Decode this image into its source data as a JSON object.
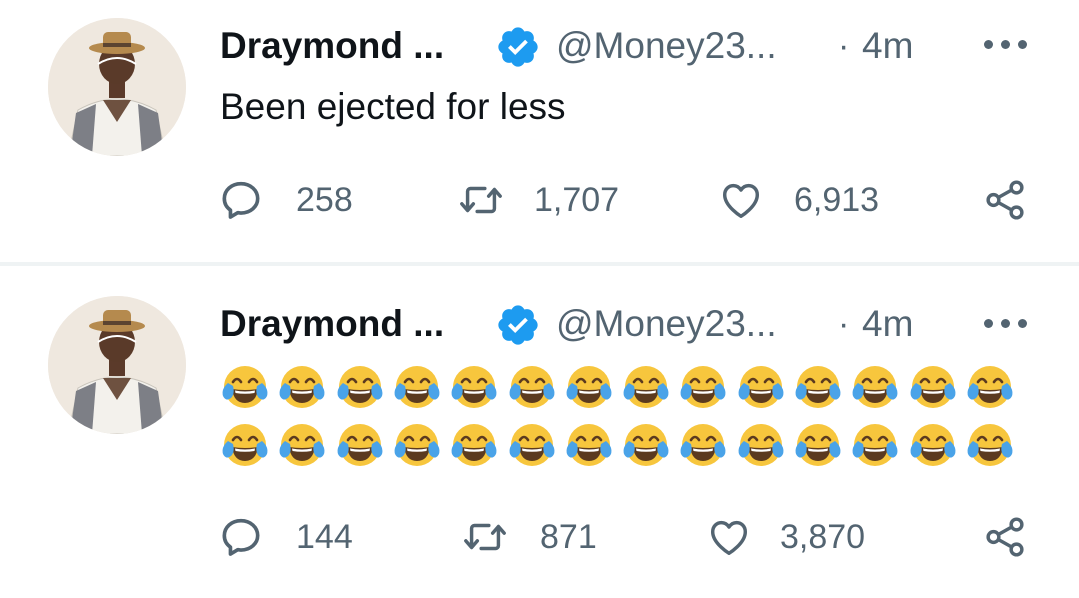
{
  "tweets": [
    {
      "author_name": "Draymond ...",
      "handle": "@Money23...",
      "dot": "·",
      "time": "4m",
      "text": "Been ejected for less",
      "replies": "258",
      "retweets": "1,707",
      "likes": "6,913"
    },
    {
      "author_name": "Draymond ...",
      "handle": "@Money23...",
      "dot": "·",
      "time": "4m",
      "emoji": "face-with-tears-of-joy",
      "emoji_rows": 2,
      "emoji_per_row": 14,
      "replies": "144",
      "retweets": "871",
      "likes": "3,870"
    }
  ],
  "colors": {
    "verified_blue": "#1d9bf0",
    "secondary_text": "#536471",
    "primary_text": "#0f1419",
    "divider": "#eff3f4"
  }
}
